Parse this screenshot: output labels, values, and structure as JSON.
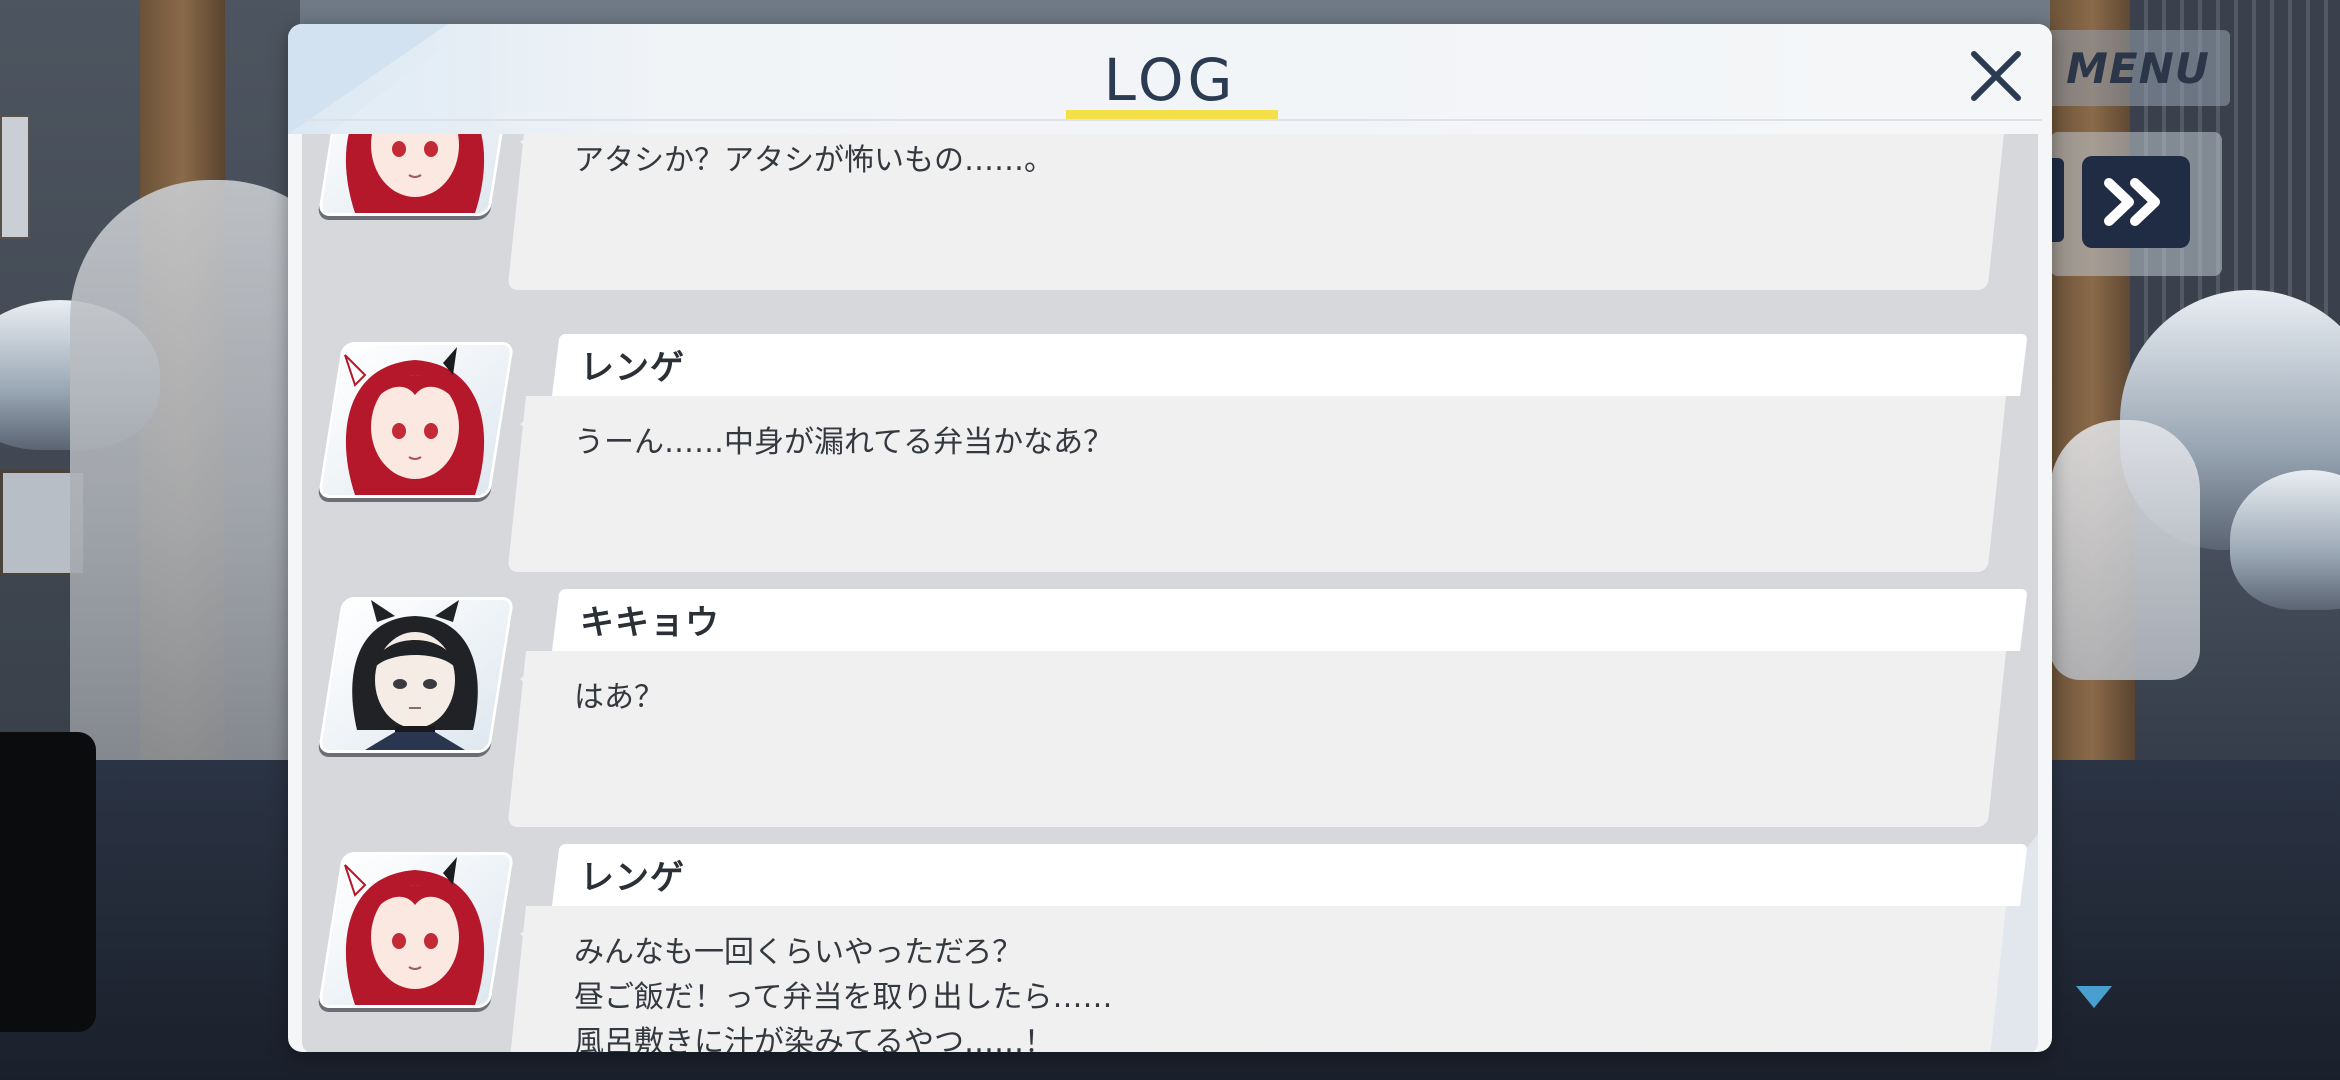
{
  "hud": {
    "menu_label": "MENU"
  },
  "log": {
    "title": "LOG",
    "entries": [
      {
        "speaker": "",
        "avatar": "renge-portrait-icon",
        "text": "アタシか？アタシが怖いもの……。"
      },
      {
        "speaker": "レンゲ",
        "avatar": "renge-portrait-icon",
        "text": "うーん……中身が漏れてる弁当かなあ？"
      },
      {
        "speaker": "キキョウ",
        "avatar": "kikyou-portrait-icon",
        "text": "はあ？"
      },
      {
        "speaker": "レンゲ",
        "avatar": "renge-portrait-icon",
        "text": "みんなも一回くらいやっただろ？\n昼ご飯だ！って弁当を取り出したら……\n風呂敷きに汁が染みてるやつ……！"
      }
    ]
  },
  "colors": {
    "title_text": "#2b3b52",
    "title_underline": "#f3df48",
    "hud_button": "#1f2c44",
    "scroll_arrow": "#4a9fd1",
    "renge_hair": "#b5182a",
    "kikyou_hair": "#202226"
  }
}
